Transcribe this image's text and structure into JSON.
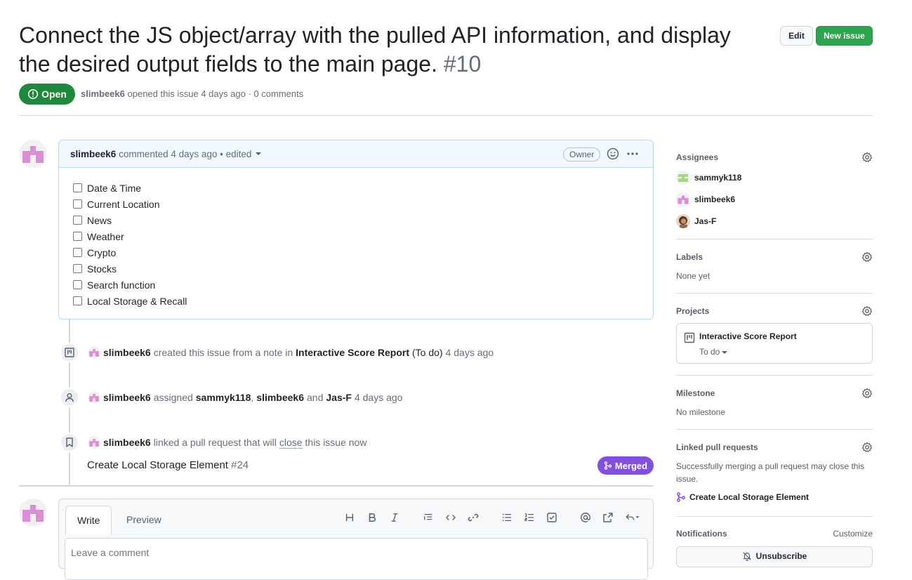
{
  "issue": {
    "title": "Connect the JS object/array with the pulled API information, and display the desired output fields to the main page.",
    "number": "#10",
    "state": "Open",
    "author": "slimbeek6",
    "meta_text": "opened this issue 4 days ago · 0 comments"
  },
  "header_actions": {
    "edit_label": "Edit",
    "new_issue_label": "New issue"
  },
  "comment": {
    "author": "slimbeek6",
    "action": "commented 4 days ago • edited",
    "badge": "Owner",
    "tasks": [
      "Date & Time",
      "Current Location",
      "News",
      "Weather",
      "Crypto",
      "Stocks",
      "Search function",
      "Local Storage & Recall"
    ]
  },
  "timeline": {
    "event1": {
      "actor": "slimbeek6",
      "text_a": "created this issue from a note in",
      "project": "Interactive Score Report",
      "column": "(To do)",
      "time": "4 days ago"
    },
    "event2": {
      "actor": "slimbeek6",
      "text_a": "assigned",
      "user1": "sammyk118",
      "sep": ",",
      "user2": "slimbeek6",
      "and": "and",
      "user3": "Jas-F",
      "time": "4 days ago"
    },
    "event3": {
      "actor": "slimbeek6",
      "text_a": "linked a pull request that will",
      "close_word": "close",
      "text_b": "this issue now",
      "pr_title": "Create Local Storage Element",
      "pr_number": "#24",
      "pr_state": "Merged"
    }
  },
  "editor": {
    "tab_write": "Write",
    "tab_preview": "Preview",
    "placeholder": "Leave a comment",
    "toolbar_icons": [
      "heading-icon",
      "bold-icon",
      "italic-icon",
      "quote-icon",
      "code-icon",
      "link-icon",
      "bulleted-list-icon",
      "numbered-list-icon",
      "task-list-icon",
      "mention-icon",
      "cross-reference-icon",
      "saved-replies-icon"
    ]
  },
  "sidebar": {
    "assignees": {
      "title": "Assignees",
      "users": [
        "sammyk118",
        "slimbeek6",
        "Jas-F"
      ]
    },
    "labels": {
      "title": "Labels",
      "value": "None yet"
    },
    "projects": {
      "title": "Projects",
      "project_name": "Interactive Score Report",
      "status": "To do"
    },
    "milestone": {
      "title": "Milestone",
      "value": "No milestone"
    },
    "linked_prs": {
      "title": "Linked pull requests",
      "description": "Successfully merging a pull request may close this issue.",
      "pr_title": "Create Local Storage Element"
    },
    "notifications": {
      "title": "Notifications",
      "customize": "Customize",
      "unsubscribe": "Unsubscribe"
    }
  },
  "colors": {
    "open_green": "#1f883d",
    "merged_purple": "#8250df",
    "comment_header_bg": "#f1f8ff",
    "identicon_pink": "#d98fd6"
  }
}
